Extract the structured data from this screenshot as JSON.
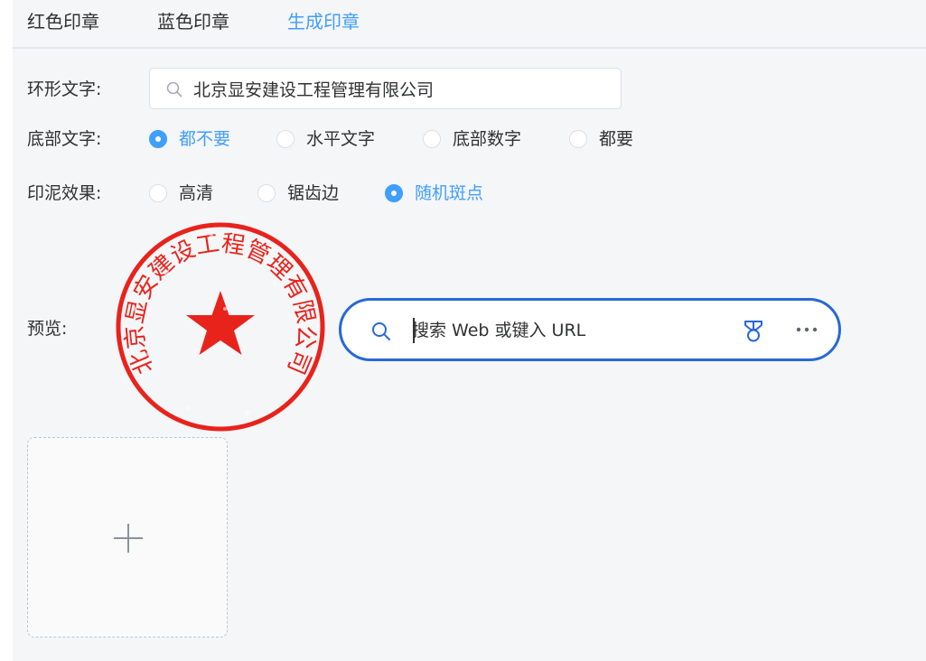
{
  "tabs": [
    {
      "label": "红色印章",
      "active": false
    },
    {
      "label": "蓝色印章",
      "active": false
    },
    {
      "label": "生成印章",
      "active": true
    }
  ],
  "ring_text": {
    "label": "环形文字:",
    "value": "北京显安建设工程管理有限公司",
    "icon": "search-icon"
  },
  "bottom_text": {
    "label": "底部文字:",
    "options": [
      "都不要",
      "水平文字",
      "底部数字",
      "都要"
    ],
    "selected": "都不要"
  },
  "ink_effect": {
    "label": "印泥效果:",
    "options": [
      "高清",
      "锯齿边",
      "随机斑点"
    ],
    "selected": "随机斑点"
  },
  "preview": {
    "label": "预览:",
    "seal": {
      "ring_text": "北京显安建设工程管理有限公司",
      "color": "#e8231c",
      "center_icon": "star-icon"
    }
  },
  "browser_search": {
    "placeholder": "搜索 Web 或键入 URL",
    "icons": [
      "search-icon",
      "medal-icon",
      "more-icon"
    ]
  },
  "upload": {
    "icon": "plus-icon"
  },
  "colors": {
    "accent": "#409eff",
    "browser_border": "#2868d6",
    "seal_red": "#e8231c"
  }
}
